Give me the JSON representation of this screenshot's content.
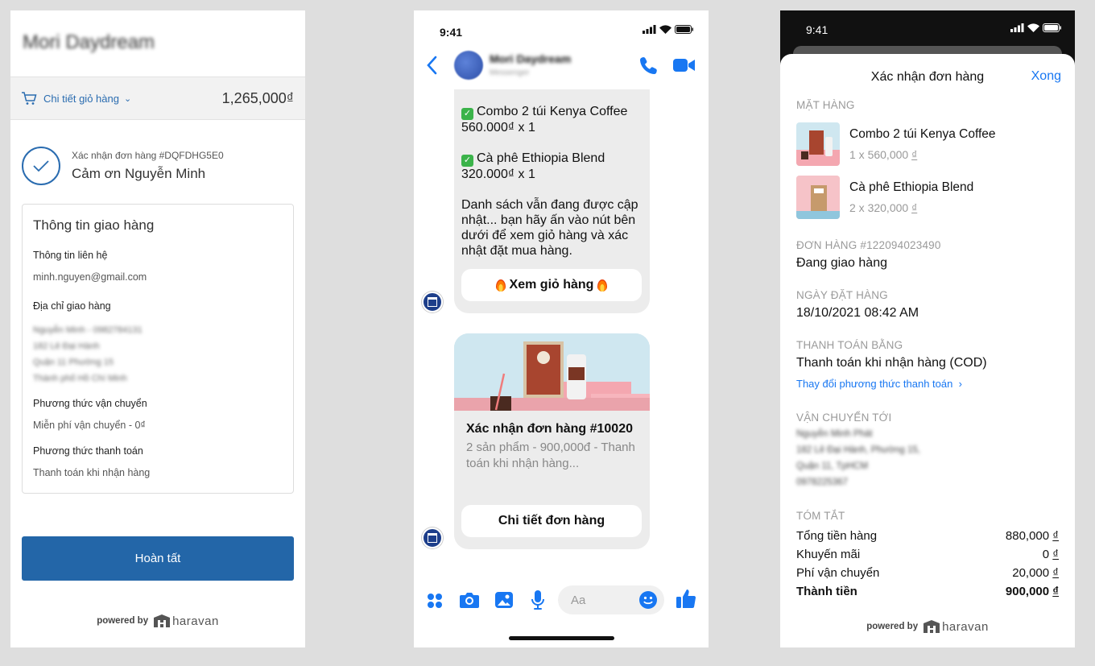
{
  "panel1": {
    "store_name": "Mori Daydream",
    "cart_label": "Chi tiết giỏ hàng",
    "cart_total": "1,265,000₫",
    "order_number": "Xác nhận đơn hàng #DQFDHG5E0",
    "thanks": "Cảm ơn Nguyễn Minh",
    "card_title": "Thông tin giao hàng",
    "contact_label": "Thông tin liên hệ",
    "contact_value": "minh.nguyen@gmail.com",
    "address_label": "Địa chỉ giao hàng",
    "address_lines": [
      "Nguyễn Minh - 0982784131",
      "182 Lê Đại Hành",
      "Quận 11 Phường 15",
      "Thành phố Hồ Chí Minh"
    ],
    "shipping_label": "Phương thức vận chuyển",
    "shipping_value": "Miễn phí vận chuyển - 0₫",
    "payment_label": "Phương thức thanh toán",
    "payment_value": "Thanh toán khi nhận hàng",
    "finish_button": "Hoàn tất",
    "powered_by": "powered by",
    "brand": "haravan"
  },
  "panel2": {
    "time": "9:41",
    "page_name": "Mori Daydream",
    "page_sub": "Messenger",
    "msg_item1_name": "Combo 2 túi Kenya Coffee",
    "msg_item1_price": "560.000₫ x 1",
    "msg_item2_name": "Cà phê Ethiopia Blend",
    "msg_item2_price": "320.000₫ x 1",
    "msg_note": "Danh sách vẫn đang được cập nhật... bạn hãy ấn vào nút bên dưới để xem giỏ hàng và xác nhật đặt mua hàng.",
    "view_cart_button": "Xem giỏ hàng",
    "order_title": "Xác nhận đơn hàng #10020",
    "order_desc": "2 sản phẩm - 900,000đ - Thanh toán khi nhận hàng...",
    "order_detail_button": "Chi tiết đơn hàng",
    "input_placeholder": "Aa"
  },
  "panel3": {
    "time": "9:41",
    "title": "Xác nhận đơn hàng",
    "done": "Xong",
    "items_label": "Mặt hàng",
    "items": [
      {
        "name": "Combo 2 túi Kenya Coffee",
        "qty_price": "1 x 560,000",
        "currency": "₫"
      },
      {
        "name": "Cà phê Ethiopia Blend",
        "qty_price": "2 x 320,000",
        "currency": "₫"
      }
    ],
    "order_label": "Đơn hàng #122094023490",
    "order_status": "Đang giao hàng",
    "date_label": "Ngày đặt hàng",
    "date_value": "18/10/2021 08:42 AM",
    "payment_label": "Thanh toán bằng",
    "payment_value": "Thanh toán khi nhận hàng (COD)",
    "change_payment": "Thay đổi phương thức thanh toán",
    "ship_label": "Vận chuyển tới",
    "ship_lines": [
      "Nguyễn Minh Phát",
      "182 Lê Đại Hành, Phường 15,",
      "Quận 11, TpHCM",
      "0978225367"
    ],
    "summary_label": "Tóm tắt",
    "summary": [
      {
        "label": "Tổng tiền hàng",
        "value": "880,000",
        "currency": "₫"
      },
      {
        "label": "Khuyến mãi",
        "value": "0",
        "currency": "₫"
      },
      {
        "label": "Phí vận chuyển",
        "value": "20,000",
        "currency": "₫"
      },
      {
        "label": "Thành tiền",
        "value": "900,000",
        "currency": "₫"
      }
    ],
    "powered_by": "powered by",
    "brand": "haravan"
  },
  "colors": {
    "accent_blue": "#2366a8",
    "messenger_blue": "#1877f2",
    "check_green": "#3bb34a"
  }
}
